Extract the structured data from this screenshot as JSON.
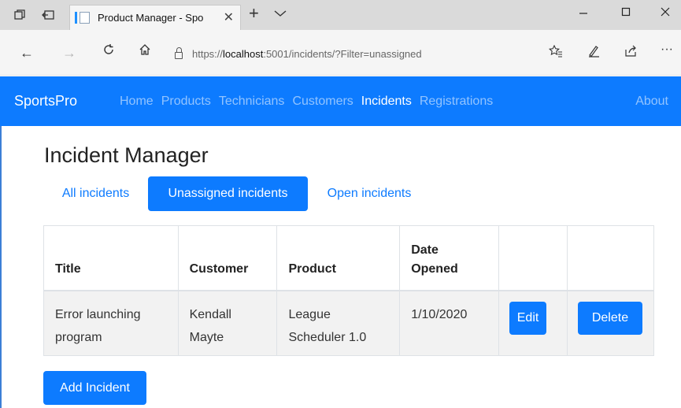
{
  "browser": {
    "tab_title": "Product Manager - Spo",
    "url_scheme": "https://",
    "url_host": "localhost",
    "url_rest": ":5001/incidents/?Filter=unassigned"
  },
  "navbar": {
    "brand": "SportsPro",
    "links": [
      "Home",
      "Products",
      "Technicians",
      "Customers",
      "Incidents",
      "Registrations"
    ],
    "active_link": "Incidents",
    "about": "About",
    "color": "#0d7bff"
  },
  "page": {
    "title": "Incident Manager",
    "filters": [
      "All incidents",
      "Unassigned incidents",
      "Open incidents"
    ],
    "active_filter": "Unassigned incidents"
  },
  "table": {
    "headers": [
      "Title",
      "Customer",
      "Product",
      "Date Opened",
      "",
      ""
    ],
    "rows": [
      {
        "title": "Error launching program",
        "customer": "Kendall Mayte",
        "product": "League Scheduler 1.0",
        "date_opened": "1/10/2020",
        "edit_label": "Edit",
        "delete_label": "Delete"
      }
    ]
  },
  "actions": {
    "add_label": "Add Incident"
  }
}
